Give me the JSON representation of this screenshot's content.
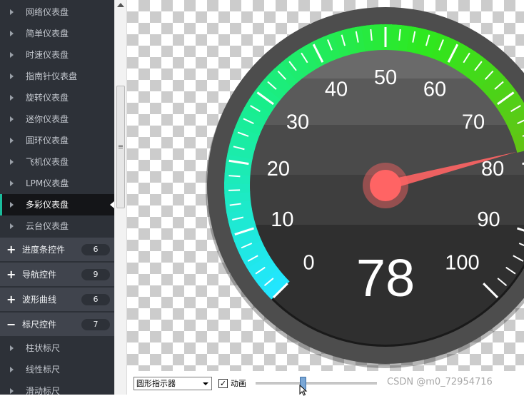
{
  "sidebar": {
    "items": [
      {
        "label": "网络仪表盘",
        "active": false
      },
      {
        "label": "简单仪表盘",
        "active": false
      },
      {
        "label": "时速仪表盘",
        "active": false
      },
      {
        "label": "指南针仪表盘",
        "active": false
      },
      {
        "label": "旋转仪表盘",
        "active": false
      },
      {
        "label": "迷你仪表盘",
        "active": false
      },
      {
        "label": "圆环仪表盘",
        "active": false
      },
      {
        "label": "飞机仪表盘",
        "active": false
      },
      {
        "label": "LPM仪表盘",
        "active": false
      },
      {
        "label": "多彩仪表盘",
        "active": true
      },
      {
        "label": "云台仪表盘",
        "active": false
      }
    ],
    "groups": [
      {
        "label": "进度条控件",
        "count": "6",
        "sign": "+"
      },
      {
        "label": "导航控件",
        "count": "9",
        "sign": "+"
      },
      {
        "label": "波形曲线",
        "count": "6",
        "sign": "+"
      },
      {
        "label": "标尺控件",
        "count": "7",
        "sign": "−"
      }
    ],
    "sub_items": [
      {
        "label": "柱状标尺"
      },
      {
        "label": "线性标尺"
      },
      {
        "label": "滑动标尺"
      }
    ]
  },
  "gauge": {
    "value": "78",
    "scale_labels": [
      "0",
      "10",
      "20",
      "30",
      "40",
      "50",
      "60",
      "70",
      "80",
      "90",
      "100"
    ],
    "min": 0,
    "max": 100,
    "colors": {
      "outer_ring": "#4d4d4d",
      "face": "#3c3c3c",
      "pointer": "#ff6464",
      "text": "#ffffff",
      "arc_start": "#22e6ff",
      "arc_mid": "#18ee8c",
      "arc_green": "#2ee81e",
      "arc_end": "#9a9e0a"
    }
  },
  "controls": {
    "pointer_style": "圆形指示器",
    "animation_checked": true,
    "animation_label": "动画",
    "slider_level": 0.39
  },
  "watermark": "CSDN @m0_72954716"
}
